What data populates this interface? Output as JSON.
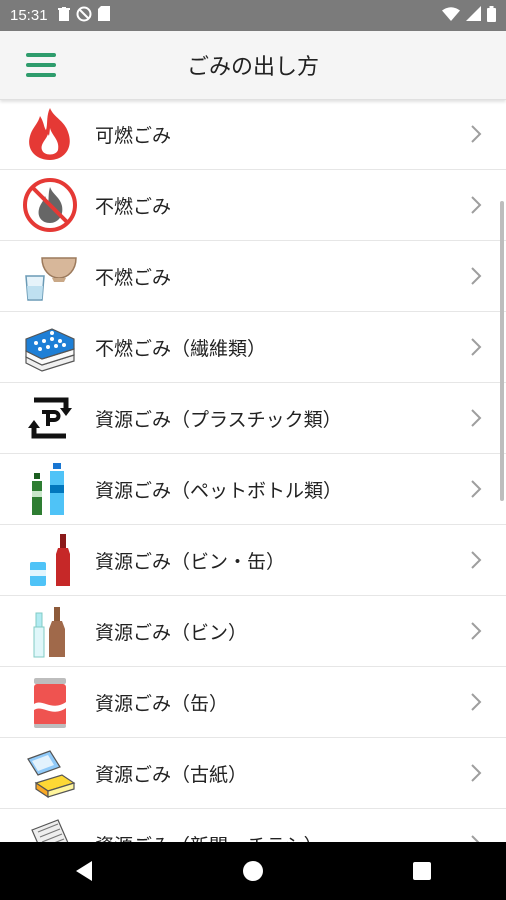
{
  "status_bar": {
    "time": "15:31",
    "left_icons": [
      "trash-icon",
      "do-not-disturb-icon",
      "sd-card-icon"
    ],
    "right_icons": [
      "wifi-icon",
      "signal-icon",
      "battery-icon"
    ]
  },
  "app_bar": {
    "title": "ごみの出し方",
    "menu_icon": "hamburger-menu-icon",
    "accent_color": "#2e9c6c"
  },
  "list": {
    "items": [
      {
        "label": "可燃ごみ",
        "icon": "burnable-fire-icon"
      },
      {
        "label": "不燃ごみ",
        "icon": "non-burnable-prohibited-fire-icon"
      },
      {
        "label": "不燃ごみ",
        "icon": "bowl-and-cup-icon"
      },
      {
        "label": "不燃ごみ（繊維類）",
        "icon": "folded-textiles-icon"
      },
      {
        "label": "資源ごみ（プラスチック類）",
        "icon": "plastic-recycle-mark-icon"
      },
      {
        "label": "資源ごみ（ペットボトル類）",
        "icon": "pet-bottles-icon"
      },
      {
        "label": "資源ごみ（ビン・缶）",
        "icon": "can-and-bottle-icon"
      },
      {
        "label": "資源ごみ（ビン）",
        "icon": "glass-bottles-icon"
      },
      {
        "label": "資源ごみ（缶）",
        "icon": "aluminum-can-icon"
      },
      {
        "label": "資源ごみ（古紙）",
        "icon": "waste-paper-icon"
      },
      {
        "label": "資源ごみ（新聞・チラシ）",
        "icon": "newspaper-icon"
      }
    ]
  },
  "nav_bar": {
    "buttons": [
      "back-icon",
      "home-icon",
      "recents-icon"
    ]
  }
}
